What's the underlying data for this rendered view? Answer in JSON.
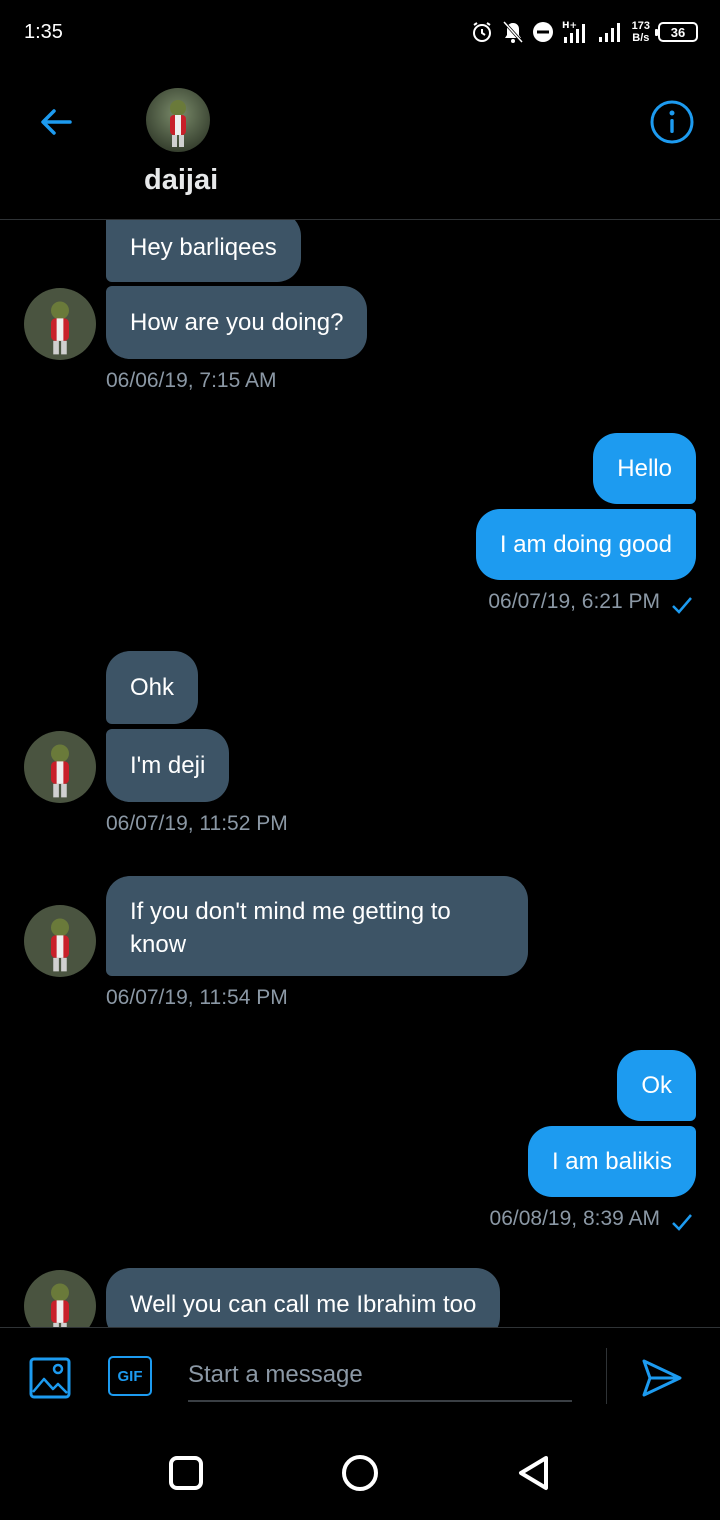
{
  "status_bar": {
    "time": "1:35",
    "net_speed_value": "173",
    "net_speed_unit": "B/s",
    "battery": "36"
  },
  "header": {
    "contact_name": "daijai"
  },
  "conversation": {
    "messages": [
      {
        "text": "Hey barliqees"
      },
      {
        "text": "How are you doing?"
      },
      {
        "text": "06/06/19, 7:15 AM"
      },
      {
        "text": "Hello"
      },
      {
        "text": "I am doing good"
      },
      {
        "text": "06/07/19, 6:21 PM"
      },
      {
        "text": "Ohk"
      },
      {
        "text": "I'm deji"
      },
      {
        "text": "06/07/19, 11:52 PM"
      },
      {
        "text": "If you don't mind me getting to know"
      },
      {
        "text": "06/07/19, 11:54 PM"
      },
      {
        "text": "Ok"
      },
      {
        "text": "I am balikis"
      },
      {
        "text": "06/08/19, 8:39 AM"
      },
      {
        "text": "Well you can call me Ibrahim too"
      }
    ]
  },
  "composer": {
    "placeholder": "Start a message",
    "gif_label": "GIF"
  },
  "colors": {
    "accent": "#1d9bf0",
    "received_bubble": "#3d5466",
    "background": "#000000",
    "timestamp": "#8b98a5"
  },
  "icons": {
    "back": "arrow-left-icon",
    "info": "info-icon",
    "media": "image-icon",
    "send": "send-icon",
    "read_receipt": "checkmark-icon"
  }
}
